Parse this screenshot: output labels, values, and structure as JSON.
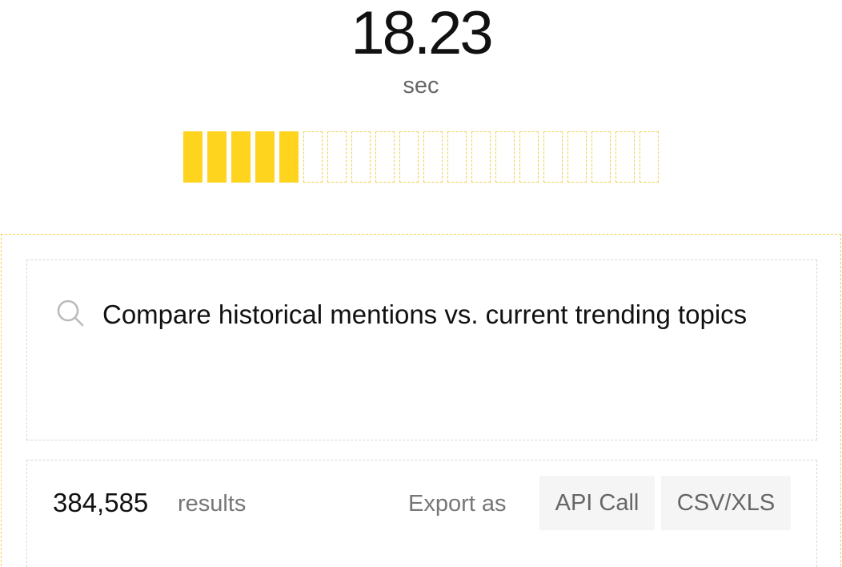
{
  "timer": {
    "value": "18.23",
    "unit": "sec"
  },
  "progress": {
    "filled_segments": 5,
    "total_segments": 20,
    "fraction": 0.25,
    "color": "#FFD41F"
  },
  "search": {
    "icon": "search-icon",
    "query": "Compare historical mentions vs. current trending topics"
  },
  "results": {
    "count": "384,585",
    "label": "results",
    "export_label": "Export as",
    "export_options": [
      "API Call",
      "CSV/XLS"
    ]
  }
}
